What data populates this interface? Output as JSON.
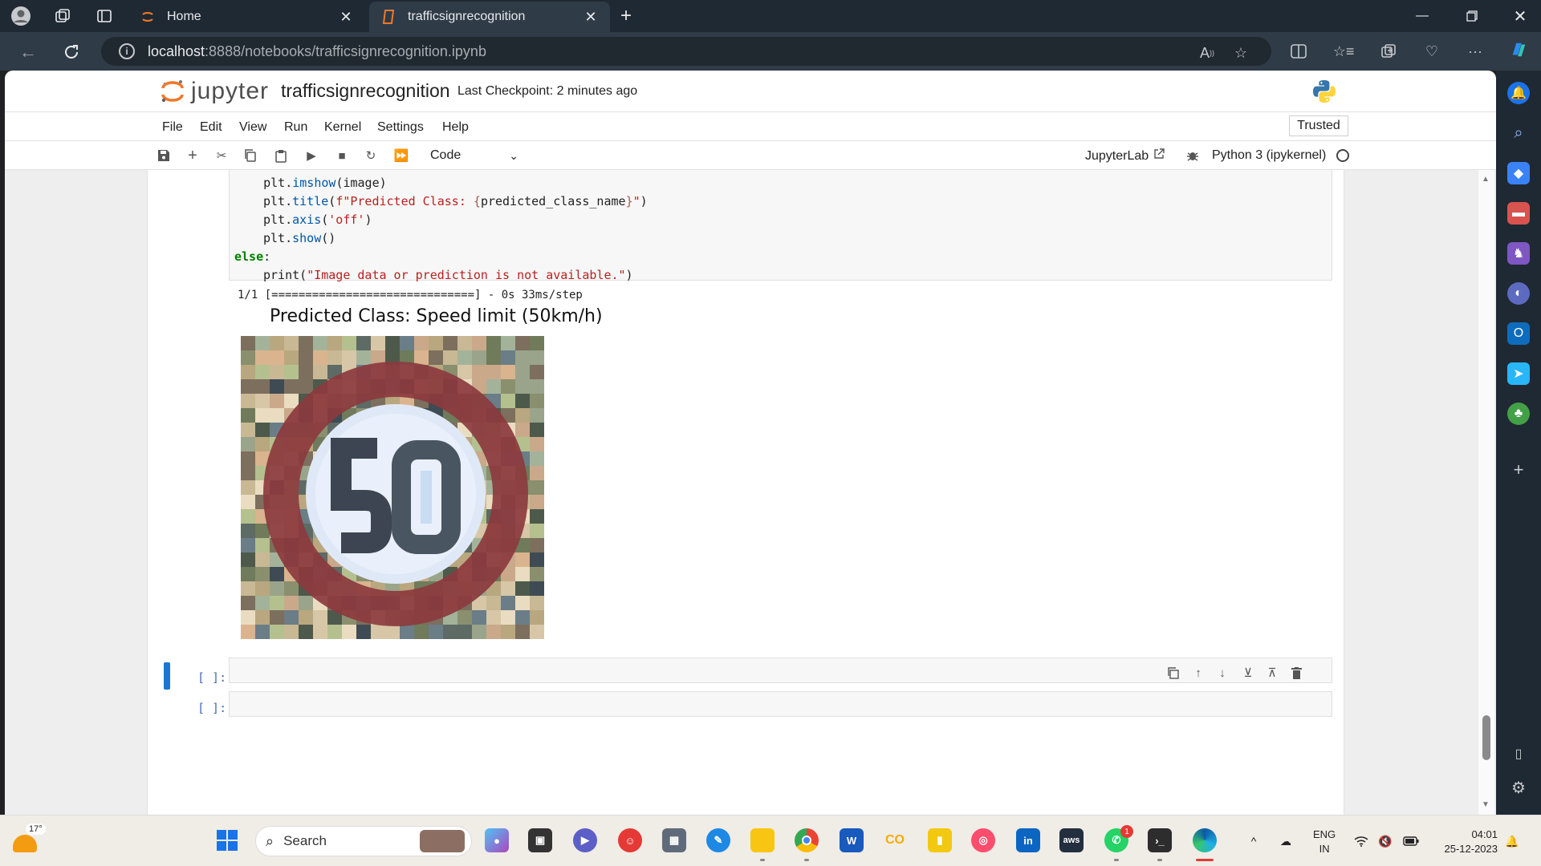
{
  "browser": {
    "tabs": [
      {
        "label": "Home",
        "active": false
      },
      {
        "label": "trafficsignrecognition",
        "active": true
      }
    ],
    "url_host": "localhost",
    "url_rest": ":8888/notebooks/trafficsignrecognition.ipynb"
  },
  "jupyter": {
    "logo_text": "jupyter",
    "notebook_title": "trafficsignrecognition",
    "checkpoint": "Last Checkpoint: 2 minutes ago",
    "menu": [
      "File",
      "Edit",
      "View",
      "Run",
      "Kernel",
      "Settings",
      "Help"
    ],
    "trusted": "Trusted",
    "cell_type": "Code",
    "jupyterlab_link": "JupyterLab",
    "kernel": "Python 3 (ipykernel)"
  },
  "cell": {
    "code": {
      "l1_indent": "    ",
      "l1_obj": "plt.",
      "l1_fn": "imshow",
      "l1_args": "(image)",
      "l2_obj": "plt.",
      "l2_fn": "title",
      "l2_open": "(",
      "l2_fstr1": "f\"Predicted Class: ",
      "l2_brace_open": "{",
      "l2_var": "predicted_class_name",
      "l2_brace_close": "}",
      "l2_fstr2": "\"",
      "l2_close": ")",
      "l3_obj": "plt.",
      "l3_fn": "axis",
      "l3_open": "(",
      "l3_str": "'off'",
      "l3_close": ")",
      "l4_obj": "plt.",
      "l4_fn": "show",
      "l4_args": "()",
      "l5_kw": "else",
      "l5_colon": ":",
      "l6_fn": "print",
      "l6_open": "(",
      "l6_str": "\"Image data or prediction is not available.\"",
      "l6_close": ")"
    },
    "output_progress": "1/1 [==============================] - 0s 33ms/step",
    "plot_title": "Predicted Class: Speed limit (50km/h)",
    "empty_prompt": "[ ]:"
  },
  "taskbar": {
    "temperature": "17°",
    "search_placeholder": "Search",
    "lang_top": "ENG",
    "lang_bottom": "IN",
    "time": "04:01",
    "date": "25-12-2023",
    "whatsapp_badge": "1",
    "colab_label": "CO",
    "aws_label": "aws",
    "linkedin_label": "in"
  }
}
